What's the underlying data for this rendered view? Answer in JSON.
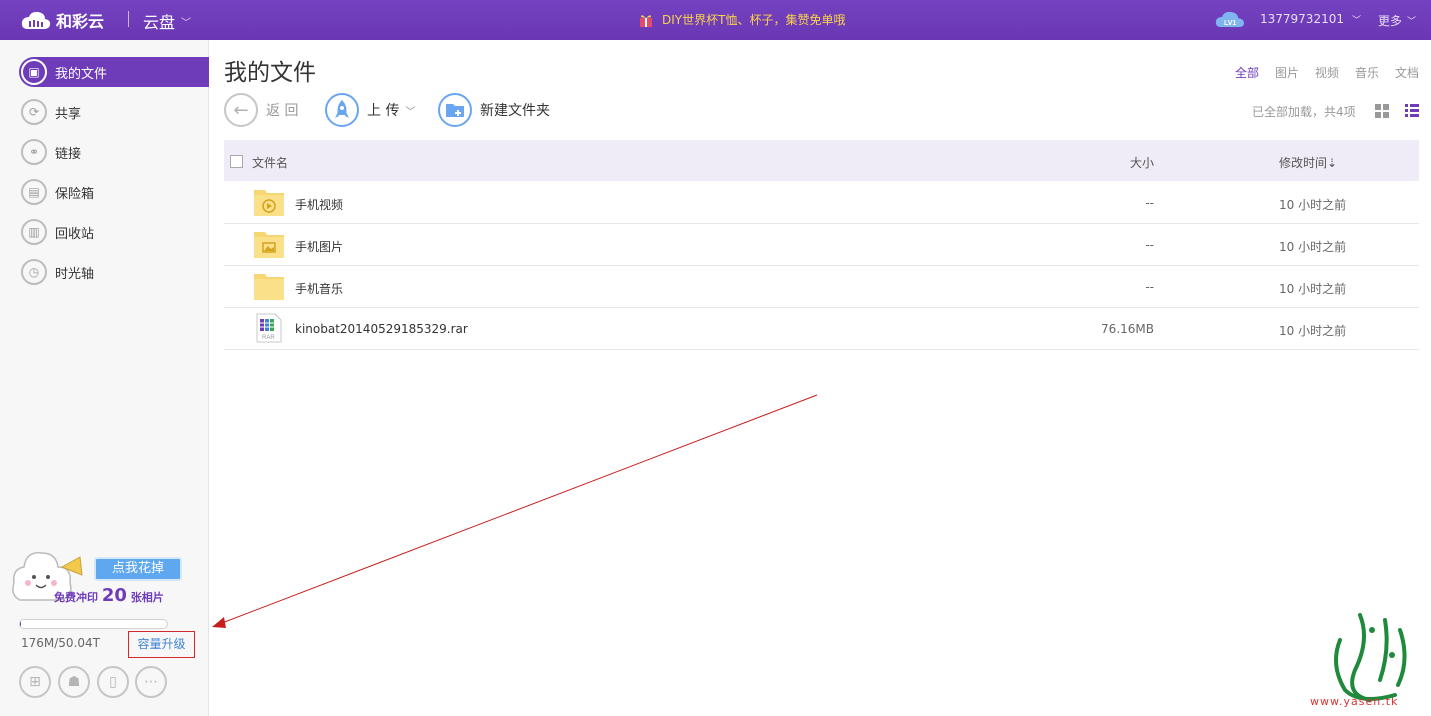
{
  "header": {
    "brand": "和彩云",
    "product": "云盘",
    "promo": "DIY世界杯T恤、杯子，集赞免单哦",
    "level_badge": "LV1",
    "phone": "13779732101",
    "more": "更多"
  },
  "sidebar": {
    "items": [
      {
        "label": "我的文件",
        "icon": "my-files-icon",
        "active": true
      },
      {
        "label": "共享",
        "icon": "share-icon"
      },
      {
        "label": "链接",
        "icon": "link-icon"
      },
      {
        "label": "保险箱",
        "icon": "safe-icon"
      },
      {
        "label": "回收站",
        "icon": "trash-icon"
      },
      {
        "label": "时光轴",
        "icon": "clock-icon"
      }
    ],
    "promo_button": "点我花掉",
    "promo_text_pre": "免费冲印",
    "promo_text_num": "20",
    "promo_text_post": "张相片",
    "quota_text": "176M/50.04T",
    "quota_fraction": 0.01,
    "upgrade": "容量升级"
  },
  "main": {
    "title": "我的文件",
    "filters": [
      "全部",
      "图片",
      "视频",
      "音乐",
      "文档"
    ],
    "active_filter": "全部",
    "back": "返 回",
    "upload": "上 传",
    "new_folder": "新建文件夹",
    "loaded_status": "已全部加载，共4项",
    "columns": {
      "name": "文件名",
      "size": "大小",
      "time": "修改时间⇣"
    },
    "files": [
      {
        "name": "手机视频",
        "size": "--",
        "time": "10 小时之前",
        "type": "folder-video"
      },
      {
        "name": "手机图片",
        "size": "--",
        "time": "10 小时之前",
        "type": "folder-image"
      },
      {
        "name": "手机音乐",
        "size": "--",
        "time": "10 小时之前",
        "type": "folder"
      },
      {
        "name": "kinobat20140529185329.rar",
        "size": "76.16MB",
        "time": "10 小时之前",
        "type": "rar"
      }
    ]
  },
  "colors": {
    "accent": "#6e3cb9",
    "promo": "#f7d34a",
    "link": "#3e83d6",
    "annotation": "#d42a2a"
  },
  "watermark_url": "www.yasen.tk"
}
